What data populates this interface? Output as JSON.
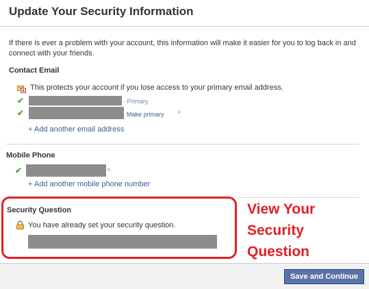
{
  "page": {
    "title": "Update Your Security Information",
    "intro": "If there is ever a problem with your account, this information will make it easier for you to log back in and connect with your friends."
  },
  "contact_email": {
    "heading": "Contact Email",
    "note": "This protects your account if you lose access to your primary email address.",
    "emails": [
      {
        "status": "- Primary"
      },
      {
        "action": "Make primary",
        "remove": "×"
      }
    ],
    "add_link": "+ Add another email address"
  },
  "mobile_phone": {
    "heading": "Mobile Phone",
    "remove": "×",
    "add_link": "+ Add another mobile phone number"
  },
  "security_question": {
    "heading": "Security Question",
    "note": "You have already set your security question."
  },
  "callout": {
    "line1": "View Your",
    "line2": "Security",
    "line3": "Question"
  },
  "footer": {
    "save_label": "Save and Continue"
  },
  "colors": {
    "link": "#3b5998",
    "check": "#5aab40",
    "callout": "#e01f26",
    "button": "#5b74a8"
  },
  "icons": [
    "check-icon",
    "envelope-icon",
    "lock-icon",
    "remove-icon"
  ]
}
